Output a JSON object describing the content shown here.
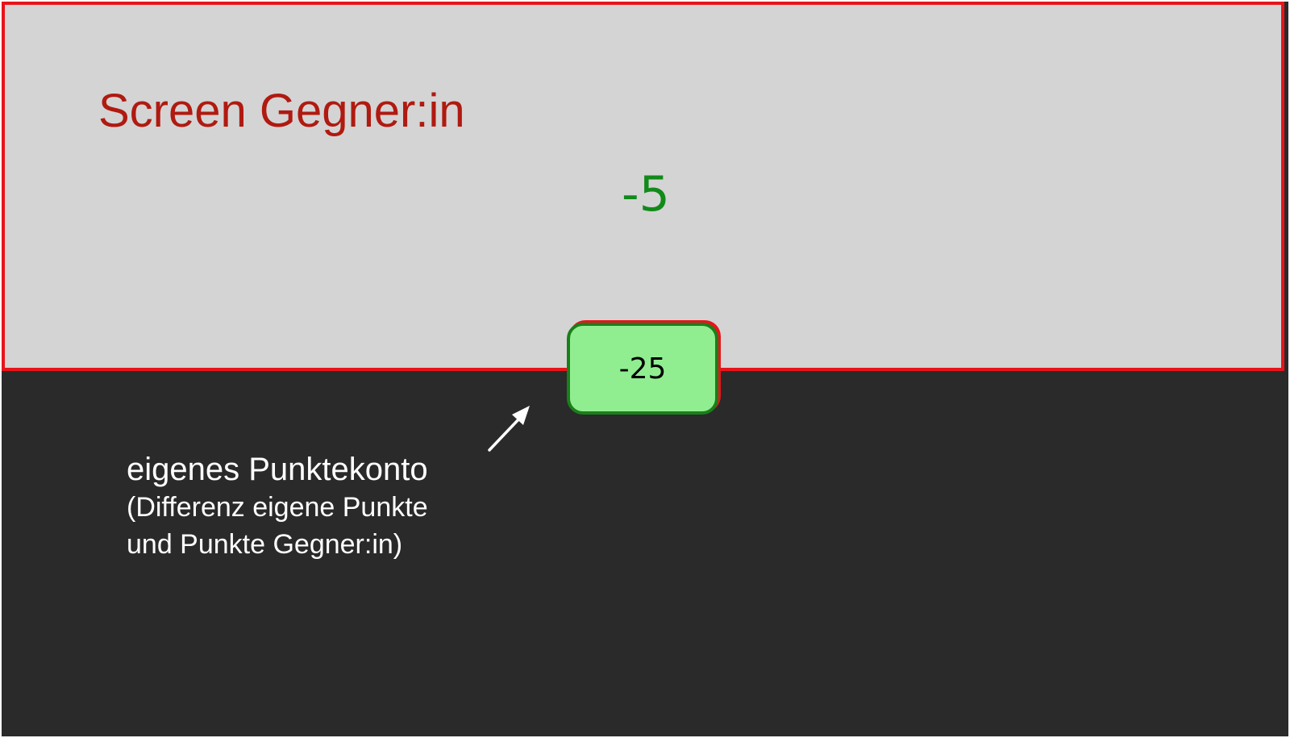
{
  "opponent_screen": {
    "title": "Screen Gegner:in",
    "score": "-5"
  },
  "own_account": {
    "value": "-25"
  },
  "annotation": {
    "title": "eigenes Punktekonto",
    "line1": "(Differenz eigene Punkte",
    "line2": "und Punkte Gegner:in)",
    "arrow_icon": "arrow-up-right-icon"
  },
  "colors": {
    "screen_border": "#e8141a",
    "screen_background": "#d4d4d4",
    "title": "#b01a10",
    "score_text": "#118a1a",
    "score_box_fill": "#90ee90",
    "score_box_border": "#1a7f1a",
    "stage_background": "#2a2a2a"
  }
}
